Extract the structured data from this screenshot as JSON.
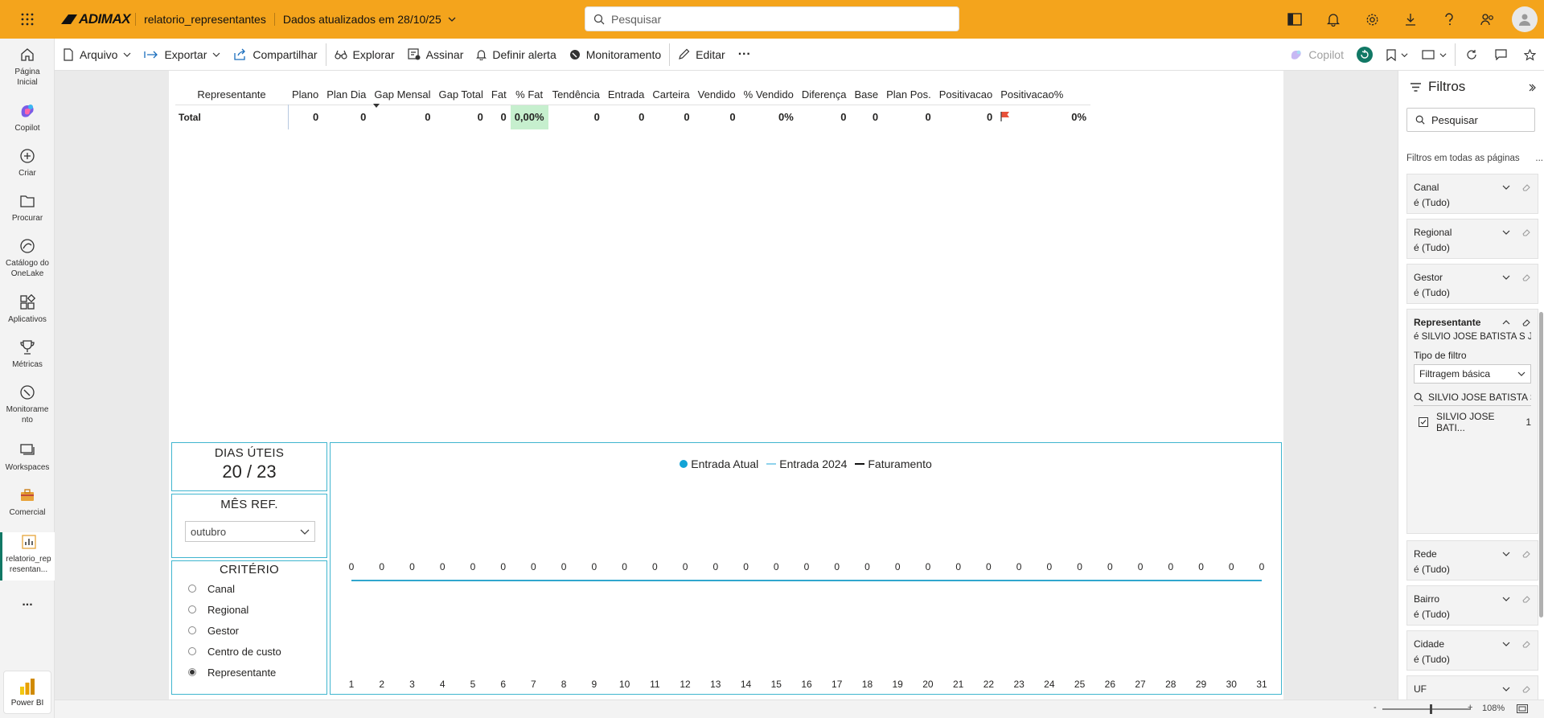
{
  "topbar": {
    "brand": "ADIMAX",
    "report_name": "relatorio_representantes",
    "updated": "Dados atualizados em 28/10/25",
    "search_placeholder": "Pesquisar"
  },
  "leftnav": [
    {
      "label": "Página Inicial",
      "icon": "home-icon"
    },
    {
      "label": "Copilot",
      "icon": "copilot-icon"
    },
    {
      "label": "Criar",
      "icon": "plus-circle-icon"
    },
    {
      "label": "Procurar",
      "icon": "folder-icon"
    },
    {
      "label": "Catálogo do OneLake",
      "icon": "onelake-icon"
    },
    {
      "label": "Aplicativos",
      "icon": "apps-icon"
    },
    {
      "label": "Métricas",
      "icon": "trophy-icon"
    },
    {
      "label": "Monitoramento",
      "icon": "monitor-icon"
    },
    {
      "label": "Workspaces",
      "icon": "workspaces-icon"
    },
    {
      "label": "Comercial",
      "icon": "briefcase-icon"
    },
    {
      "label": "relatorio_representan...",
      "icon": "report-icon"
    }
  ],
  "leftnav_more": "...",
  "powerbi_label": "Power BI",
  "toolbar": {
    "arquivo": "Arquivo",
    "exportar": "Exportar",
    "compartilhar": "Compartilhar",
    "explorar": "Explorar",
    "assinar": "Assinar",
    "definir_alerta": "Definir alerta",
    "monitoramento": "Monitoramento",
    "editar": "Editar",
    "more": "···",
    "copilot": "Copilot"
  },
  "matrix": {
    "headers": [
      "Representante",
      "Plano",
      "Plan Dia",
      "Gap Mensal",
      "Gap Total",
      "Fat",
      "% Fat",
      "Tendência",
      "Entrada",
      "Carteira",
      "Vendido",
      "% Vendido",
      "Diferença",
      "Base",
      "Plan Pos.",
      "Positivacao",
      "Positivacao%"
    ],
    "total_label": "Total",
    "total_values": [
      "0",
      "0",
      "0",
      "0",
      "0",
      "0,00%",
      "0",
      "0",
      "0",
      "0",
      "0%",
      "0",
      "0",
      "0",
      "0",
      "0%"
    ]
  },
  "dias_uteis": {
    "title": "DIAS ÚTEIS",
    "value": "20 / 23"
  },
  "mes_ref": {
    "title": "MÊS REF.",
    "selected": "outubro"
  },
  "criterio": {
    "title": "CRITÉRIO",
    "options": [
      "Canal",
      "Regional",
      "Gestor",
      "Centro de custo",
      "Representante"
    ],
    "selected_index": 4
  },
  "chart_data": {
    "type": "line",
    "series": [
      {
        "name": "Entrada Atual",
        "color": "#12a3d6",
        "values": [
          0,
          0,
          0,
          0,
          0,
          0,
          0,
          0,
          0,
          0,
          0,
          0,
          0,
          0,
          0,
          0,
          0,
          0,
          0,
          0,
          0,
          0,
          0,
          0,
          0,
          0,
          0,
          0,
          0,
          0,
          0
        ]
      },
      {
        "name": "Entrada 2024",
        "color": "#8fd3ec",
        "values": [
          0,
          0,
          0,
          0,
          0,
          0,
          0,
          0,
          0,
          0,
          0,
          0,
          0,
          0,
          0,
          0,
          0,
          0,
          0,
          0,
          0,
          0,
          0,
          0,
          0,
          0,
          0,
          0,
          0,
          0,
          0
        ]
      },
      {
        "name": "Faturamento",
        "color": "#111111",
        "values": [
          0,
          0,
          0,
          0,
          0,
          0,
          0,
          0,
          0,
          0,
          0,
          0,
          0,
          0,
          0,
          0,
          0,
          0,
          0,
          0,
          0,
          0,
          0,
          0,
          0,
          0,
          0,
          0,
          0,
          0,
          0
        ]
      }
    ],
    "x": [
      1,
      2,
      3,
      4,
      5,
      6,
      7,
      8,
      9,
      10,
      11,
      12,
      13,
      14,
      15,
      16,
      17,
      18,
      19,
      20,
      21,
      22,
      23,
      24,
      25,
      26,
      27,
      28,
      29,
      30,
      31
    ],
    "data_labels": [
      "0",
      "0",
      "0",
      "0",
      "0",
      "0",
      "0",
      "0",
      "0",
      "0",
      "0",
      "0",
      "0",
      "0",
      "0",
      "0",
      "0",
      "0",
      "0",
      "0",
      "0",
      "0",
      "0",
      "0",
      "0",
      "0",
      "0",
      "0",
      "0",
      "0",
      "0"
    ],
    "legend": "top-center",
    "title": "",
    "xlabel": "",
    "ylabel": ""
  },
  "filters": {
    "title": "Filtros",
    "search_placeholder": "Pesquisar",
    "all_pages": "Filtros em todas as páginas",
    "all_pages_more": "...",
    "cards": [
      {
        "name": "Canal",
        "value": "é (Tudo)"
      },
      {
        "name": "Regional",
        "value": "é (Tudo)"
      },
      {
        "name": "Gestor",
        "value": "é (Tudo)"
      }
    ],
    "expanded": {
      "name": "Representante",
      "value": "é SILVIO JOSE BATISTA S J ...",
      "type_label": "Tipo de filtro",
      "type_value": "Filtragem básica",
      "search_value": "SILVIO JOSE BATISTA S J",
      "item_label": "SILVIO JOSE BATI...",
      "item_count": "1"
    },
    "cards_after": [
      {
        "name": "Rede",
        "value": "é (Tudo)"
      },
      {
        "name": "Bairro",
        "value": "é (Tudo)"
      },
      {
        "name": "Cidade",
        "value": "é (Tudo)"
      },
      {
        "name": "UF",
        "value": ""
      }
    ]
  },
  "status": {
    "zoom_minus": "-",
    "zoom_plus": "+",
    "zoom": "108%",
    "zoom_level": 0.54
  }
}
